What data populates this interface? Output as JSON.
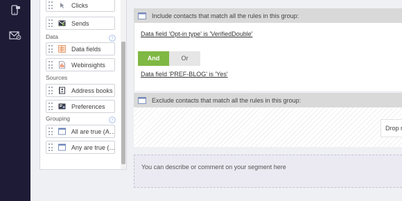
{
  "nav": {
    "icons": [
      "phone-icon",
      "email-settings-icon"
    ]
  },
  "toolbox": {
    "items_top": [
      {
        "label": "Clicks",
        "icon": "click-icon"
      },
      {
        "label": "Sends",
        "icon": "send-icon"
      }
    ],
    "data_section": {
      "label": "Data",
      "items": [
        {
          "label": "Data fields",
          "icon": "data-fields-icon"
        },
        {
          "label": "Webinsights",
          "icon": "webinsights-icon"
        }
      ]
    },
    "sources_section": {
      "label": "Sources",
      "items": [
        {
          "label": "Address books",
          "icon": "address-book-icon"
        },
        {
          "label": "Preferences",
          "icon": "preferences-icon"
        }
      ]
    },
    "grouping_section": {
      "label": "Grouping",
      "items": [
        {
          "label": "All are true (A…",
          "icon": "group-box-icon"
        },
        {
          "label": "Any are true (…",
          "icon": "group-box-icon"
        }
      ]
    },
    "help_icon": "question-circle-icon"
  },
  "include_group": {
    "header": "Include contacts that match all the rules in this group:",
    "rule1": "Data field 'Opt-in type' is 'VerifiedDouble'",
    "toggle": {
      "and_label": "And",
      "or_label": "Or",
      "selected": "And"
    },
    "rule2": "Data field 'PREF-BLOG' is 'Yes'"
  },
  "exclude_group": {
    "header": "Exclude contacts that match all the rules in this group:",
    "drop_label": "Drop r"
  },
  "comment": {
    "placeholder": "You can describe or comment on your segment here"
  },
  "colors": {
    "nav_bg": "#1e1b36",
    "and_active": "#7fb843",
    "group_header": "#d9d9d9"
  }
}
